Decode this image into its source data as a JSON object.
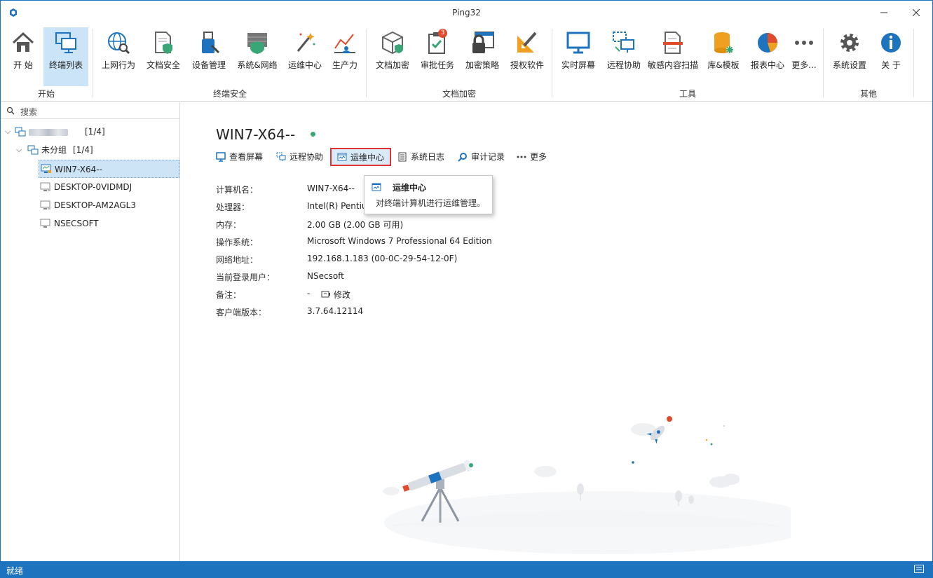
{
  "window": {
    "title": "Ping32",
    "controls": [
      "minimize",
      "maximize",
      "close"
    ]
  },
  "ribbon": {
    "groups": [
      {
        "label": "开始"
      },
      {
        "label": "终端安全"
      },
      {
        "label": "文档加密"
      },
      {
        "label": "工具"
      },
      {
        "label": "其他"
      }
    ],
    "buttons": [
      {
        "label": "开 始",
        "icon": "home-icon"
      },
      {
        "label": "终端列表",
        "icon": "terminal-list-icon",
        "active": true
      },
      {
        "label": "上网行为",
        "icon": "web-behavior-icon"
      },
      {
        "label": "文档安全",
        "icon": "document-security-icon"
      },
      {
        "label": "设备管理",
        "icon": "device-management-icon"
      },
      {
        "label": "系统&网络",
        "icon": "system-network-icon"
      },
      {
        "label": "运维中心",
        "icon": "ops-center-icon"
      },
      {
        "label": "生产力",
        "icon": "productivity-icon"
      },
      {
        "label": "文档加密",
        "icon": "document-encryption-icon"
      },
      {
        "label": "审批任务",
        "icon": "approval-task-icon",
        "badge": "3"
      },
      {
        "label": "加密策略",
        "icon": "encryption-policy-icon"
      },
      {
        "label": "授权软件",
        "icon": "authorized-software-icon"
      },
      {
        "label": "实时屏幕",
        "icon": "realtime-screen-icon"
      },
      {
        "label": "远程协助",
        "icon": "remote-assist-icon"
      },
      {
        "label": "敏感内容扫描",
        "icon": "sensitive-scan-icon"
      },
      {
        "label": "库&模板",
        "icon": "library-template-icon"
      },
      {
        "label": "报表中心",
        "icon": "report-center-icon"
      },
      {
        "label": "更多...",
        "icon": "more-icon"
      },
      {
        "label": "系统设置",
        "icon": "settings-icon"
      },
      {
        "label": "关 于",
        "icon": "about-icon"
      }
    ]
  },
  "sidebar": {
    "search_placeholder": "搜索",
    "root": {
      "count": "[1/4]"
    },
    "group": {
      "label": "未分组",
      "count": "[1/4]"
    },
    "computers": [
      {
        "name": "WIN7-X64--",
        "online": true,
        "selected": true
      },
      {
        "name": "DESKTOP-0VIDMDJ",
        "online": false
      },
      {
        "name": "DESKTOP-AM2AGL3",
        "online": false
      },
      {
        "name": "NSECSOFT",
        "online": false
      }
    ]
  },
  "detail": {
    "hostname": "WIN7-X64--",
    "actions": [
      {
        "label": "查看屏幕",
        "icon": "view-screen-icon"
      },
      {
        "label": "远程协助",
        "icon": "remote-assist-icon"
      },
      {
        "label": "运维中心",
        "icon": "ops-center-icon",
        "highlighted": true
      },
      {
        "label": "系统日志",
        "icon": "system-log-icon"
      },
      {
        "label": "审计记录",
        "icon": "audit-search-icon"
      },
      {
        "label": "更多",
        "icon": "more-dots-icon"
      }
    ],
    "info": [
      {
        "key": "计算机名：",
        "value": "WIN7-X64--"
      },
      {
        "key": "处理器：",
        "value": "Intel(R) Pentium(R) CPU G2030 @ 3.00GHz"
      },
      {
        "key": "内存：",
        "value": "2.00 GB (2.00 GB 可用)"
      },
      {
        "key": "操作系统：",
        "value": "Microsoft Windows 7 Professional 64 Edition"
      },
      {
        "key": "网络地址：",
        "value": "192.168.1.183  (00-0C-29-54-12-0F)"
      },
      {
        "key": "当前登录用户：",
        "value": "NSecsoft"
      },
      {
        "key": "备注：",
        "value": "-"
      },
      {
        "key": "客户端版本：",
        "value": "3.7.64.12114"
      }
    ],
    "remark_edit_label": "修改",
    "tooltip": {
      "title": "运维中心",
      "description": "对终端计算机进行运维管理。"
    }
  },
  "statusbar": {
    "text": "就绪"
  },
  "colors": {
    "accent": "#1e73be",
    "ribbon_active": "#cce4f7",
    "highlight_border": "#e03131",
    "online_dot": "#3aa676"
  }
}
